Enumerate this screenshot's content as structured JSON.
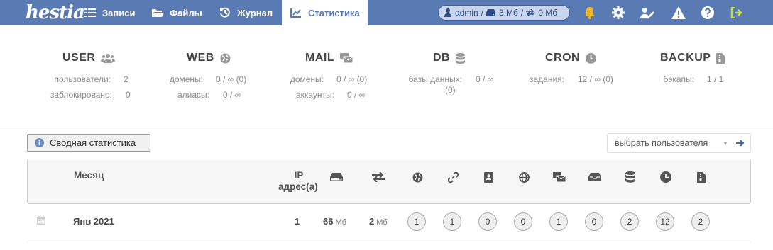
{
  "app": {
    "logo": "hestia"
  },
  "nav": {
    "records": "Записи",
    "files": "Файлы",
    "log": "Журнал",
    "stats": "Статистика"
  },
  "user_pill": {
    "user": "admin",
    "disk": "3 Мб",
    "bandwidth": "0 Мб"
  },
  "colors": {
    "topbar": "#5a7ab4",
    "bell": "#f0b732",
    "logout": "#c6e04b",
    "active_tab_text": "#5a7ab4"
  },
  "summary": {
    "user": {
      "title": "USER",
      "rows": [
        {
          "label": "пользователи:",
          "value": "2"
        },
        {
          "label": "заблокировано:",
          "value": "0"
        }
      ]
    },
    "web": {
      "title": "WEB",
      "rows": [
        {
          "label": "домены:",
          "value": "0 / ∞ (0)"
        },
        {
          "label": "алиасы:",
          "value": "0 / ∞"
        }
      ]
    },
    "mail": {
      "title": "MAIL",
      "rows": [
        {
          "label": "домены:",
          "value": "0 / ∞ (0)"
        },
        {
          "label": "аккаунты:",
          "value": "0 / ∞"
        }
      ]
    },
    "db": {
      "title": "DB",
      "rows": [
        {
          "label": "базы данных:",
          "value": "0 / ∞"
        },
        {
          "label": "",
          "value": "(0)"
        }
      ]
    },
    "cron": {
      "title": "CRON",
      "rows": [
        {
          "label": "задания:",
          "value": "12 / ∞ (0)"
        }
      ]
    },
    "backup": {
      "title": "BACKUP",
      "rows": [
        {
          "label": "бэкапы:",
          "value": "1 / 1"
        }
      ]
    }
  },
  "toolbar": {
    "overall_stats": "Сводная статистика",
    "user_select": "выбрать пользователя"
  },
  "table": {
    "col_month": "Месяц",
    "col_ip_line1": "IP",
    "col_ip_line2": "адрес(а)",
    "rows": [
      {
        "month": "Янв 2021",
        "ip": "1",
        "disk": "66",
        "disk_unit": "Мб",
        "bandwidth": "2",
        "bandwidth_unit": "Мб",
        "web_domains": "1",
        "web_aliases": "1",
        "dns_domains": "0",
        "dns_records": "0",
        "mail_domains": "1",
        "mail_accounts": "0",
        "databases": "2",
        "cron_jobs": "12",
        "backups": "2"
      }
    ]
  }
}
